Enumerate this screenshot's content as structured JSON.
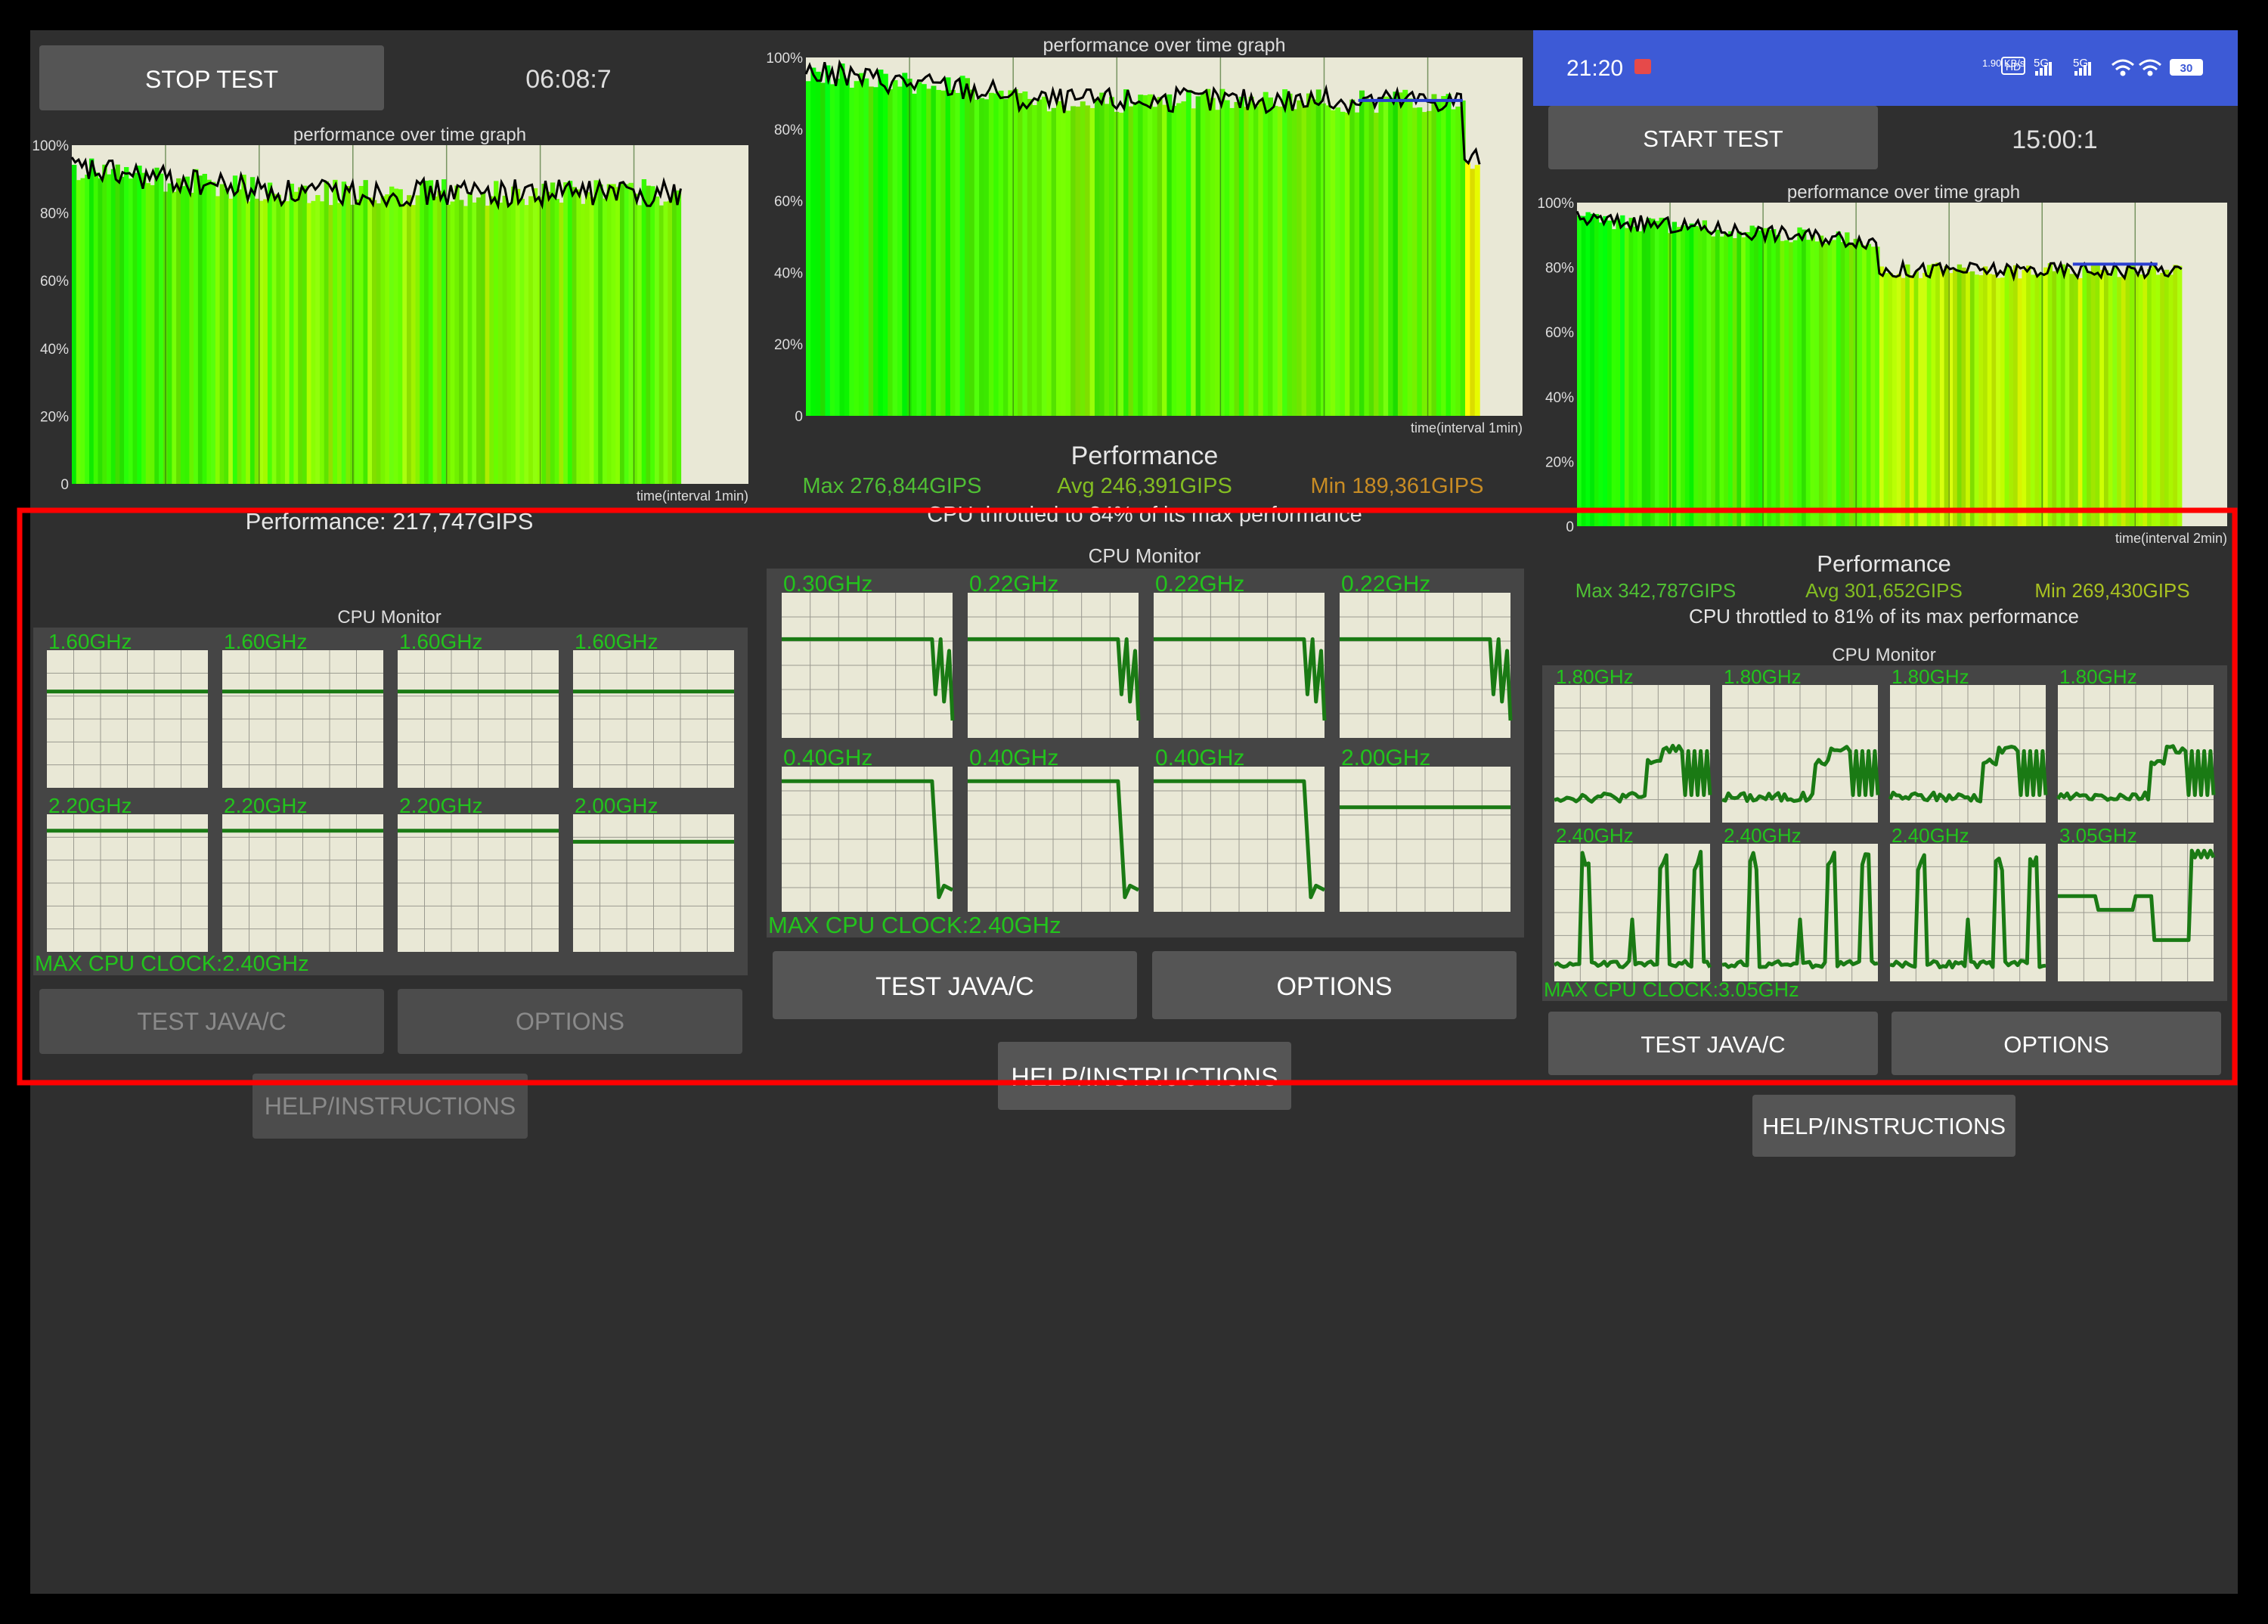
{
  "colors": {
    "background": "#2f2f2f",
    "frame": "#000000",
    "button": "#555555",
    "button_disabled": "#4c4c4c",
    "plot_bg": "#e9e8d6",
    "cpu_line": "#1a7a14",
    "cpu_label": "#22c41c",
    "perf_line": "#000000",
    "avg_line": "#2a3fd1",
    "max_text": "#4fbf34",
    "avg_text": "#83bd22",
    "min_text_mid": "#c88c24",
    "min_text_right": "#a9c121",
    "status_bar": "#3d5ad6",
    "highlight": "#ff0000"
  },
  "panels": [
    {
      "id": "left",
      "test_button": "STOP TEST",
      "timer": "06:08:7",
      "graph": {
        "title": "performance over time graph",
        "y_ticks": [
          "100%",
          "80%",
          "60%",
          "40%",
          "20%",
          "0"
        ],
        "x_label": "time(interval 1min)",
        "fill_ratio": 0.9
      },
      "performance_line": "Performance: 217,747GIPS",
      "cpu_monitor": {
        "title": "CPU Monitor",
        "cores": [
          {
            "freq": "1.60GHz",
            "level": 0.7
          },
          {
            "freq": "1.60GHz",
            "level": 0.7
          },
          {
            "freq": "1.60GHz",
            "level": 0.7
          },
          {
            "freq": "1.60GHz",
            "level": 0.7
          },
          {
            "freq": "2.20GHz",
            "level": 0.88
          },
          {
            "freq": "2.20GHz",
            "level": 0.88
          },
          {
            "freq": "2.20GHz",
            "level": 0.88
          },
          {
            "freq": "2.00GHz",
            "level": 0.8
          }
        ],
        "max_clock": "MAX CPU CLOCK:2.40GHz"
      },
      "buttons": {
        "java": "TEST JAVA/C",
        "options": "OPTIONS",
        "help": "HELP/INSTRUCTIONS"
      }
    },
    {
      "id": "middle",
      "graph": {
        "title": "performance over time graph",
        "y_ticks": [
          "100%",
          "80%",
          "60%",
          "40%",
          "20%",
          "0"
        ],
        "x_label": "time(interval 1min)",
        "fill_ratio": 0.94
      },
      "performance": {
        "title": "Performance",
        "max": "Max 276,844GIPS",
        "avg": "Avg 246,391GIPS",
        "min": "Min 189,361GIPS",
        "throttle": "CPU throttled to 84% of its max performance"
      },
      "cpu_monitor": {
        "title": "CPU Monitor",
        "cores": [
          {
            "freq": "0.30GHz"
          },
          {
            "freq": "0.22GHz"
          },
          {
            "freq": "0.22GHz"
          },
          {
            "freq": "0.22GHz"
          },
          {
            "freq": "0.40GHz"
          },
          {
            "freq": "0.40GHz"
          },
          {
            "freq": "0.40GHz"
          },
          {
            "freq": "2.00GHz"
          }
        ],
        "max_clock": "MAX CPU CLOCK:2.40GHz"
      },
      "buttons": {
        "java": "TEST JAVA/C",
        "options": "OPTIONS",
        "help": "HELP/INSTRUCTIONS"
      }
    },
    {
      "id": "right",
      "status_bar": {
        "time": "21:20",
        "net_speed": "1.90\nKB/s",
        "hd": "HD",
        "sig1": "5G",
        "sig2": "5G",
        "battery": "30"
      },
      "test_button": "START TEST",
      "timer": "15:00:1",
      "graph": {
        "title": "performance over time graph",
        "y_ticks": [
          "100%",
          "80%",
          "60%",
          "40%",
          "20%",
          "0"
        ],
        "x_label": "time(interval 2min)",
        "fill_ratio": 0.93
      },
      "performance": {
        "title": "Performance",
        "max": "Max 342,787GIPS",
        "avg": "Avg 301,652GIPS",
        "min": "Min 269,430GIPS",
        "throttle": "CPU throttled to 81% of its max performance"
      },
      "cpu_monitor": {
        "title": "CPU Monitor",
        "cores": [
          {
            "freq": "1.80GHz"
          },
          {
            "freq": "1.80GHz"
          },
          {
            "freq": "1.80GHz"
          },
          {
            "freq": "1.80GHz"
          },
          {
            "freq": "2.40GHz"
          },
          {
            "freq": "2.40GHz"
          },
          {
            "freq": "2.40GHz"
          },
          {
            "freq": "3.05GHz"
          }
        ],
        "max_clock": "MAX CPU CLOCK:3.05GHz"
      },
      "buttons": {
        "java": "TEST JAVA/C",
        "options": "OPTIONS",
        "help": "HELP/INSTRUCTIONS"
      }
    }
  ]
}
